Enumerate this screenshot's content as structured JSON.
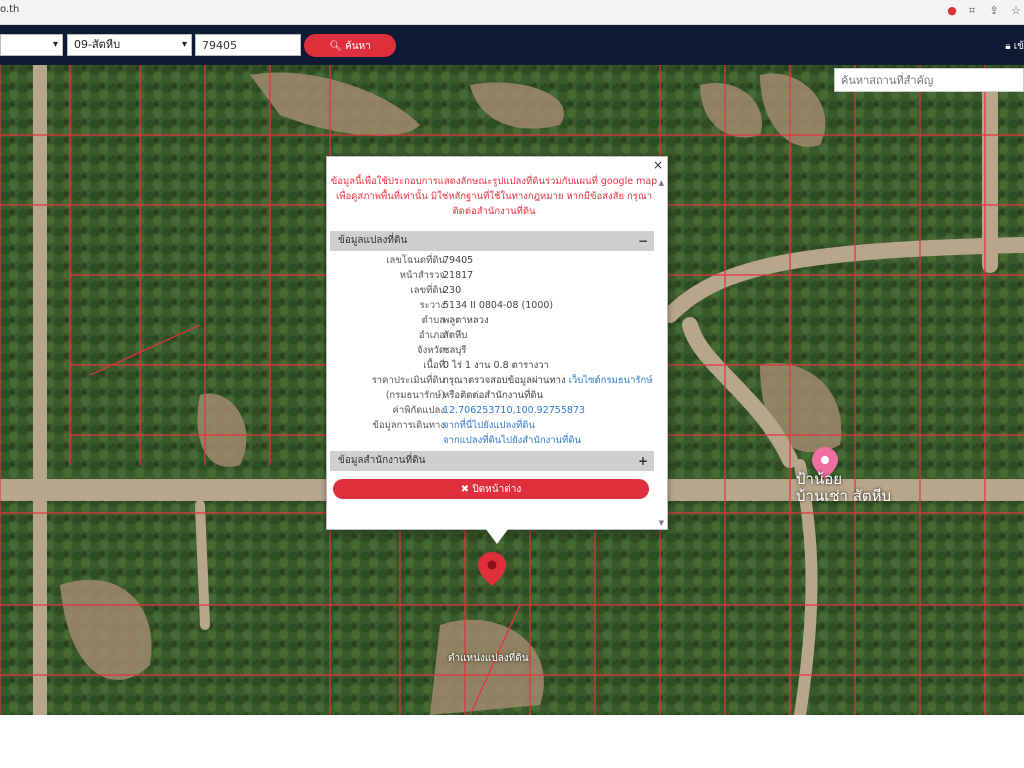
{
  "browser": {
    "url": "o.th"
  },
  "nav": {
    "district_select": "09-สัตหีบ",
    "parcel_number": "79405",
    "search_label": "ค้นหา",
    "user_label": "เข้"
  },
  "map": {
    "place_search_placeholder": "ค้นหาสถานที่สำคัญ",
    "place_label_line1": "ป้าน้อย",
    "place_label_line2": "บ้านเช่า สัตหีบ",
    "marker_label": "ตำแหน่งแปลงที่ดิน"
  },
  "popup": {
    "disclaimer": "ข้อมูลนี้เพื่อใช้ประกอบการแสดงลักษณะรูปแปลงที่ดินร่วมกับแผนที่ google map เพื่อดูสภาพพื้นที่เท่านั้น มิใช่หลักฐานที่ใช้ในทางกฎหมาย หากมีข้อสงสัย กรุณาติดต่อสำนักงานที่ดิน",
    "section_parcel": "ข้อมูลแปลงที่ดิน",
    "section_parcel_toggle": "−",
    "rows": [
      {
        "key": "เลขโฉนดที่ดิน",
        "value": "79405"
      },
      {
        "key": "หน้าสำรวจ",
        "value": "21817"
      },
      {
        "key": "เลขที่ดิน",
        "value": "230"
      },
      {
        "key": "ระวาง",
        "value": "5134 II 0804-08 (1000)"
      },
      {
        "key": "ตำบล",
        "value": "พลูตาหลวง"
      },
      {
        "key": "อำเภอ",
        "value": "สัตหีบ"
      },
      {
        "key": "จังหวัด",
        "value": "ชลบุรี"
      },
      {
        "key": "เนื้อที่",
        "value": "0 ไร่ 1 งาน 0.8 ตารางวา"
      }
    ],
    "price_key": "ราคาประเมินที่ดิน",
    "price_value": "กรุณาตรวจสอบข้อมูลผ่านทาง",
    "price_link": "เว็บไซต์กรมธนารักษ์",
    "treasury_key": "(กรมธนารักษ์)",
    "treasury_value": "หรือติดต่อสำนักงานที่ดิน",
    "coord_key": "ค่าพิกัดแปลง",
    "coord_value": "12.706253710,100.92755873",
    "travel_key": "ข้อมูลการเดินทาง",
    "travel_link1": "จากที่นี่ไปยังแปลงที่ดิน",
    "travel_link2": "จากแปลงที่ดินไปยังสำนักงานที่ดิน",
    "section_office": "ข้อมูลสำนักงานที่ดิน",
    "section_office_toggle": "+",
    "close_button": "✖ ปิดหน้าต่าง"
  },
  "colors": {
    "nav_bg": "#0d1a33",
    "accent_red": "#e02f3c",
    "parcel_line": "#e8313d",
    "link_blue": "#2f7bd0"
  }
}
